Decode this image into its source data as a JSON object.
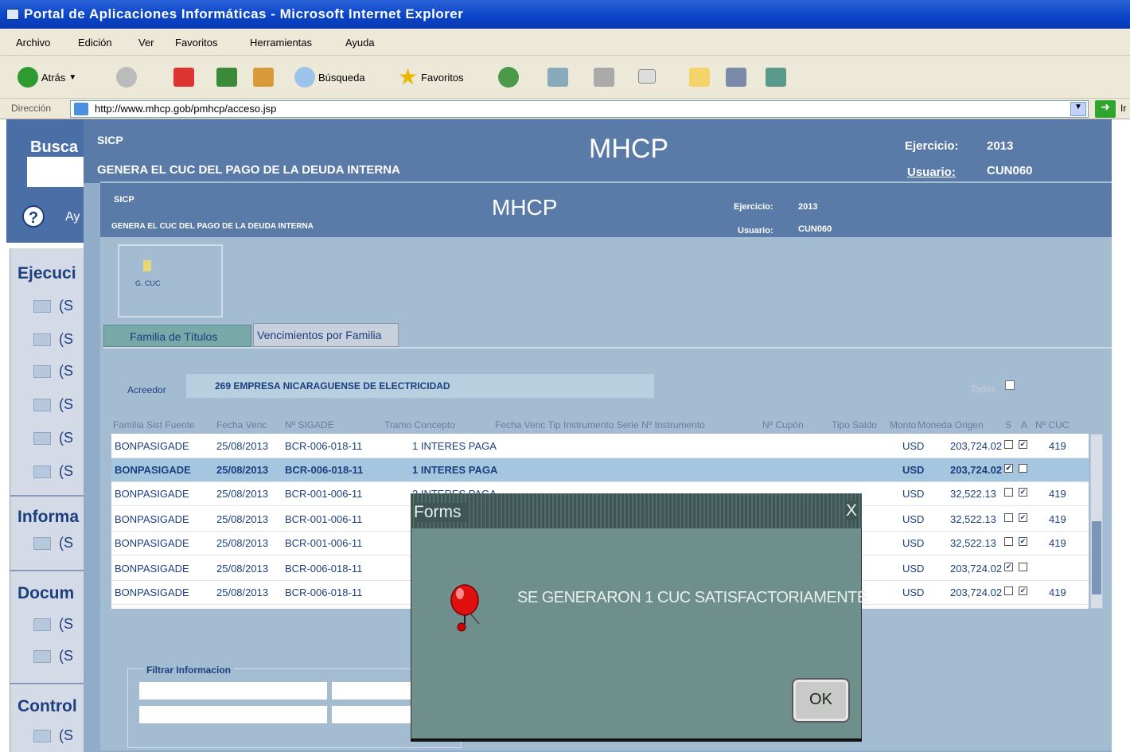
{
  "window": {
    "title": "Portal de Aplicaciones Informáticas - Microsoft Internet Explorer"
  },
  "menu": [
    "Archivo",
    "Edición",
    "Ver",
    "Favoritos",
    "Herramientas",
    "Ayuda"
  ],
  "toolbar": {
    "back": "Atrás",
    "search": "Búsqueda",
    "favorites": "Favoritos"
  },
  "address": {
    "label": "Dirección",
    "url": "http://www.mhcp.gob/pmhcp/acceso.jsp",
    "go": "Ir"
  },
  "portal": {
    "search_label": "Busca",
    "help": "Ay",
    "sections": [
      {
        "title": "Ejecuci",
        "items": [
          "(S",
          "(S",
          "(S",
          "(S",
          "(S",
          "(S"
        ]
      },
      {
        "title": "Informa",
        "items": [
          "(S"
        ]
      },
      {
        "title": "Docum",
        "items": [
          "(S",
          "(S"
        ]
      },
      {
        "title": "Control",
        "items": [
          "(S"
        ]
      }
    ]
  },
  "outer_form": {
    "sicp": "SICP",
    "title": "GENERA EL CUC DEL PAGO DE LA DEUDA INTERNA",
    "org": "MHCP",
    "ejercicio_label": "Ejercicio:",
    "ejercicio": "2013",
    "usuario_label": "Usuario:",
    "usuario": "CUN060"
  },
  "inner_form": {
    "sicp": "SICP",
    "title": "GENERA EL CUC DEL PAGO DE LA DEUDA INTERNA",
    "org": "MHCP",
    "ejercicio_label": "Ejercicio:",
    "ejercicio": "2013",
    "usuario_label": "Usuario:",
    "usuario": "CUN060"
  },
  "cuc_button": "G. CUC",
  "tabs": [
    "Familia de Títulos",
    "Vencimientos por Familia"
  ],
  "acreedor": {
    "label": "Acreedor",
    "value": "269 EMPRESA NICARAGUENSE DE ELECTRICIDAD"
  },
  "todos_label": "Todos",
  "columns": [
    "Familia Sist Fuente",
    "Fecha Venc",
    "Nº SIGADE",
    "Tramo Concepto",
    "Fecha Venc Tip Instrumento Serie Nº Instrumento",
    "Nº Cupón",
    "Tipo Saldo",
    "Monto",
    "Moneda Origen",
    "S",
    "A",
    "Nº CUC"
  ],
  "rows": [
    {
      "familia": "BONPASIGADE",
      "fecha": "25/08/2013",
      "sigade": "BCR-006-018-11",
      "concepto": "1 INTERES PAGA",
      "moneda": "USD",
      "monto": "203,724.02",
      "s": false,
      "a": true,
      "cuc": "419",
      "selected": false
    },
    {
      "familia": "BONPASIGADE",
      "fecha": "25/08/2013",
      "sigade": "BCR-006-018-11",
      "concepto": "1 INTERES PAGA",
      "moneda": "USD",
      "monto": "203,724.02",
      "s": true,
      "a": false,
      "cuc": "",
      "selected": true
    },
    {
      "familia": "BONPASIGADE",
      "fecha": "25/08/2013",
      "sigade": "BCR-001-006-11",
      "concepto": "2 INTERES PAGA",
      "moneda": "USD",
      "monto": "32,522.13",
      "s": false,
      "a": true,
      "cuc": "419",
      "selected": false
    },
    {
      "familia": "BONPASIGADE",
      "fecha": "25/08/2013",
      "sigade": "BCR-001-006-11",
      "concepto": "",
      "moneda": "USD",
      "monto": "32,522.13",
      "s": false,
      "a": true,
      "cuc": "419",
      "selected": false
    },
    {
      "familia": "BONPASIGADE",
      "fecha": "25/08/2013",
      "sigade": "BCR-001-006-11",
      "concepto": "",
      "moneda": "USD",
      "monto": "32,522.13",
      "s": false,
      "a": true,
      "cuc": "419",
      "selected": false
    },
    {
      "familia": "BONPASIGADE",
      "fecha": "25/08/2013",
      "sigade": "BCR-006-018-11",
      "concepto": "",
      "moneda": "USD",
      "monto": "203,724.02",
      "s": true,
      "a": false,
      "cuc": "",
      "selected": false
    },
    {
      "familia": "BONPASIGADE",
      "fecha": "25/08/2013",
      "sigade": "BCR-006-018-11",
      "concepto": "",
      "moneda": "USD",
      "monto": "203,724.02",
      "s": false,
      "a": true,
      "cuc": "419",
      "selected": false
    }
  ],
  "filter": {
    "label": "Filtrar Informacion"
  },
  "dialog": {
    "title": "Forms",
    "message": "SE GENERARON 1 CUC SATISFACTORIAMENTE.",
    "ok": "OK",
    "close": "X"
  }
}
